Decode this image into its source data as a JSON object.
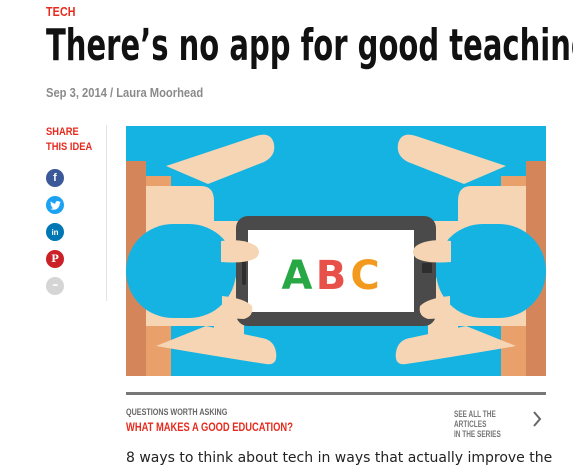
{
  "article": {
    "category": "TECH",
    "title": "There’s no app for good teaching",
    "byline": "Sep 3, 2014 / Laura Moorhead",
    "teaser": "8 ways to think about tech in ways that actually improve the"
  },
  "share": {
    "label_line1": "SHARE",
    "label_line2": "THIS IDEA",
    "buttons": [
      {
        "name": "facebook",
        "glyph": "f",
        "color": "#3b5998"
      },
      {
        "name": "twitter",
        "color": "#1da1f2"
      },
      {
        "name": "linkedin",
        "glyph": "in",
        "color": "#0077b5"
      },
      {
        "name": "pinterest",
        "glyph": "P",
        "color": "#cb2027"
      },
      {
        "name": "more",
        "glyph": "•••",
        "color": "#d5d5d5"
      }
    ]
  },
  "hero": {
    "letters": [
      "A",
      "B",
      "C"
    ],
    "letter_colors": [
      "#27a844",
      "#e8504a",
      "#f39a1e"
    ],
    "background": "#14b3e2",
    "icon": "phone-held-in-hands"
  },
  "series": {
    "kicker": "QUESTIONS WORTH ASKING",
    "title": "WHAT MAKES A GOOD EDUCATION?",
    "see_all_line1": "SEE ALL THE ARTICLES",
    "see_all_line2": "IN THE SERIES"
  },
  "colors": {
    "brand_red": "#e62b1e",
    "text": "#111111",
    "muted": "#8a8a8a"
  }
}
